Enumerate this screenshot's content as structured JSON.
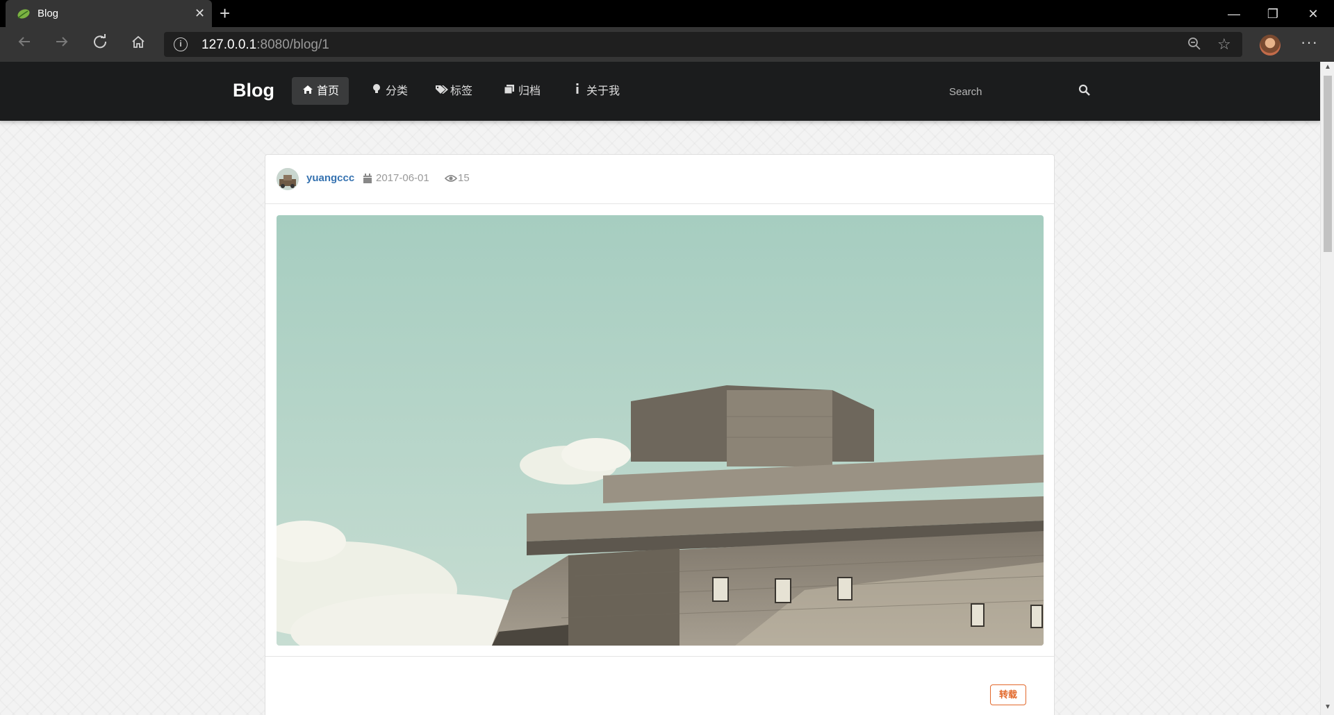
{
  "browser": {
    "tab_title": "Blog",
    "tab_close": "✕",
    "new_tab": "+",
    "url_host": "127.0.0.1",
    "url_rest": ":8080/blog/1",
    "window_minimize": "—",
    "window_restore": "❐",
    "window_close": "✕",
    "more_menu": "···"
  },
  "site": {
    "brand": "Blog",
    "menu": [
      {
        "label": "首页",
        "icon": "home-icon",
        "active": true
      },
      {
        "label": "分类",
        "icon": "lightbulb-icon",
        "active": false
      },
      {
        "label": "标签",
        "icon": "tags-icon",
        "active": false
      },
      {
        "label": "归档",
        "icon": "clone-icon",
        "active": false
      },
      {
        "label": "关于我",
        "icon": "info-icon",
        "active": false
      }
    ],
    "search_placeholder": "Search"
  },
  "post": {
    "author": "yuangccc",
    "date": "2017-06-01",
    "views": "15",
    "type_badge": "转载",
    "hero_image": "concrete-bunker-against-teal-sky"
  },
  "colors": {
    "nav_bg": "#1b1c1d",
    "author_link": "#3572b0",
    "badge_orange": "#e2682a",
    "sky": "#a9cfc3"
  }
}
